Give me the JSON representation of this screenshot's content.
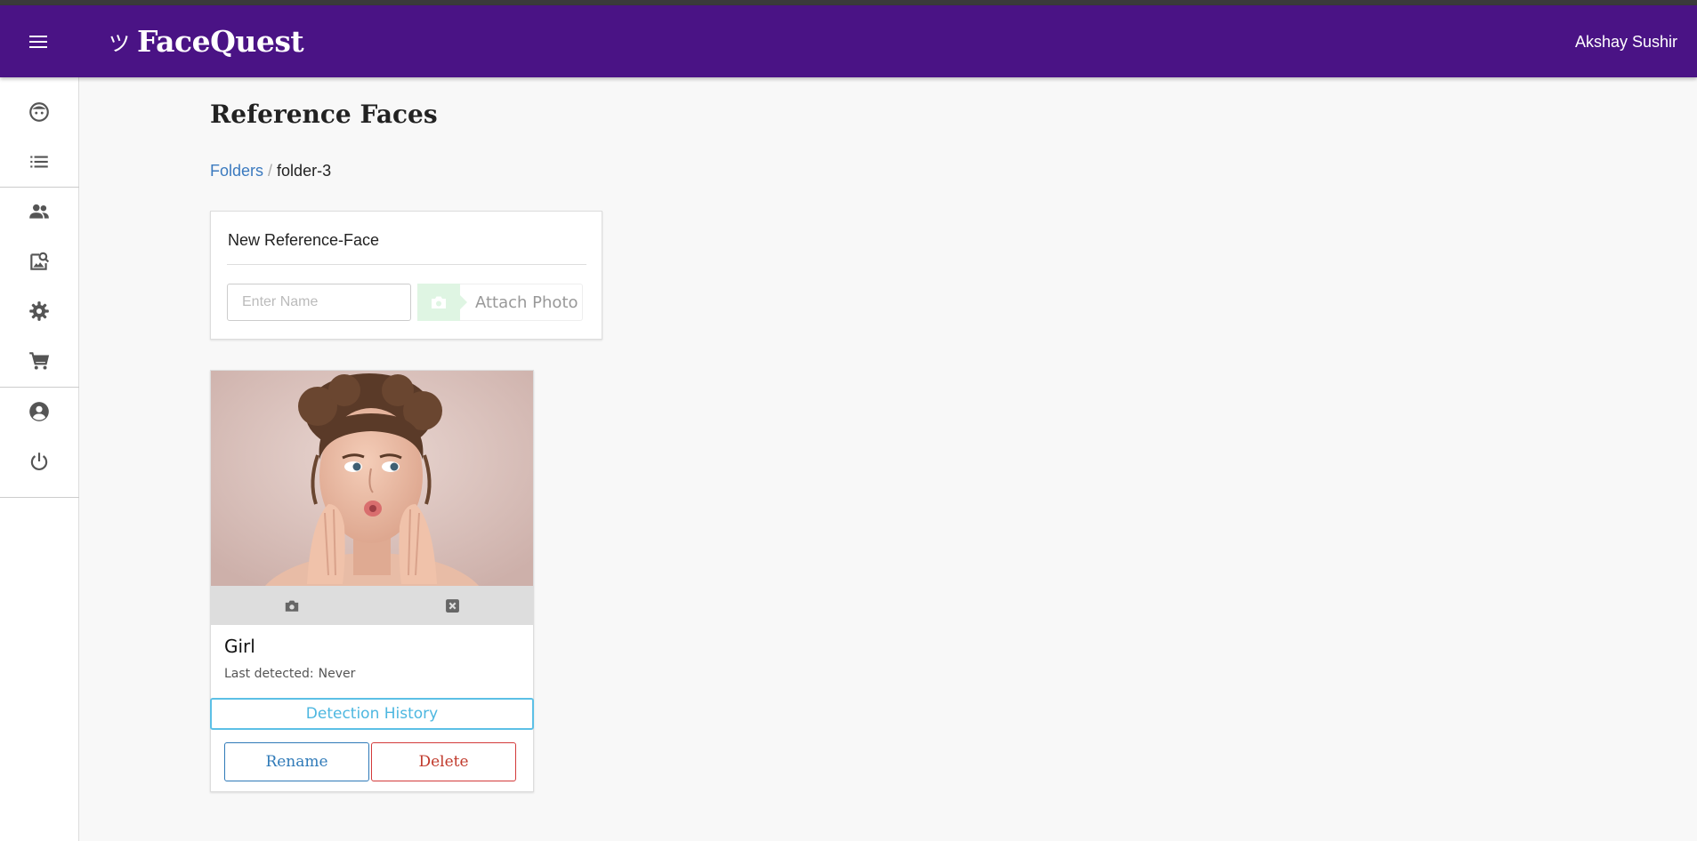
{
  "app": {
    "brand_mark": "ツ",
    "brand_name": "FaceQuest",
    "user_name": "Akshay Sushir"
  },
  "sidebar": {
    "items": [
      {
        "icon": "face-icon"
      },
      {
        "icon": "list-icon"
      },
      {
        "icon": "people-icon"
      },
      {
        "icon": "image-search-icon"
      },
      {
        "icon": "gear-icon"
      },
      {
        "icon": "cart-icon"
      },
      {
        "icon": "account-icon"
      },
      {
        "icon": "power-icon"
      }
    ]
  },
  "page": {
    "title": "Reference Faces",
    "breadcrumb": {
      "root": "Folders",
      "separator": "/",
      "current": "folder-3"
    }
  },
  "new_face": {
    "title": "New Reference-Face",
    "name_placeholder": "Enter Name",
    "name_value": "",
    "attach_label": "Attach Photo",
    "attach_icon": "camera-icon"
  },
  "faces": [
    {
      "name": "Girl",
      "last_detected_label": "Last detected:",
      "last_detected_value": "Never",
      "photo_actions": [
        "camera-icon",
        "close-box-icon"
      ],
      "history_label": "Detection History",
      "rename_label": "Rename",
      "delete_label": "Delete"
    }
  ],
  "colors": {
    "appbar": "#4a1385",
    "link": "#3b7abf",
    "history": "#5cc0e6",
    "rename": "#2f7ab8",
    "delete": "#d33a3a",
    "attach_accent": "#dff5e3"
  }
}
